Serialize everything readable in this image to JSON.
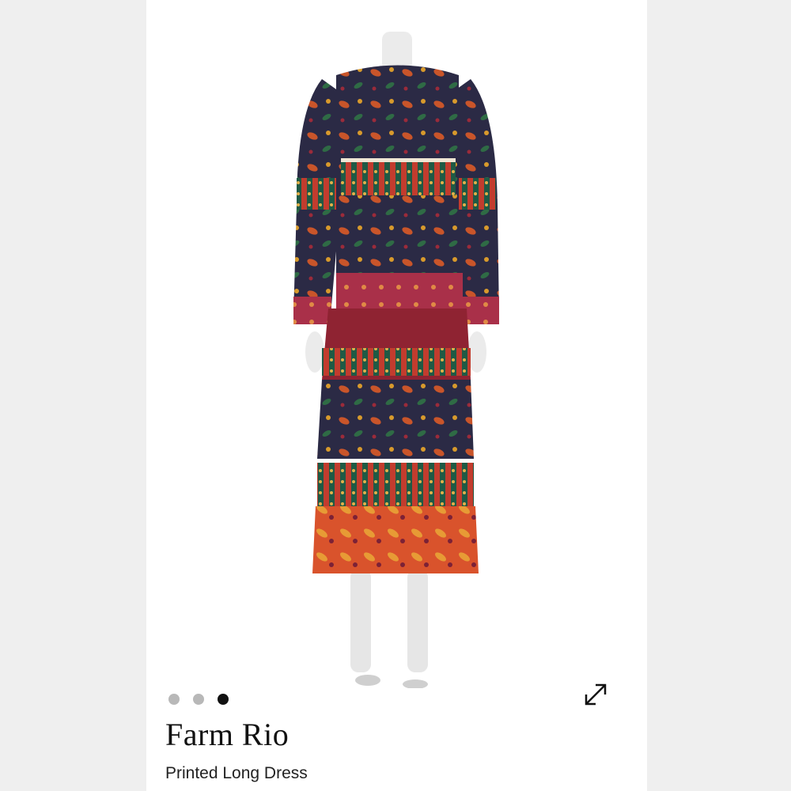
{
  "product": {
    "brand": "Farm Rio",
    "name": "Printed Long Dress",
    "image": {
      "subject": "mannequin-dress-back-view",
      "icon": "product-photo"
    }
  },
  "carousel": {
    "total_slides": 3,
    "active_slide": 3,
    "dot_color": "#b8b8b8",
    "active_dot_color": "#111111"
  },
  "controls": {
    "expand_icon": "expand-diagonal-arrows-icon"
  },
  "colors": {
    "background": "#f6f6f6",
    "card": "#ffffff",
    "text": "#111111"
  }
}
